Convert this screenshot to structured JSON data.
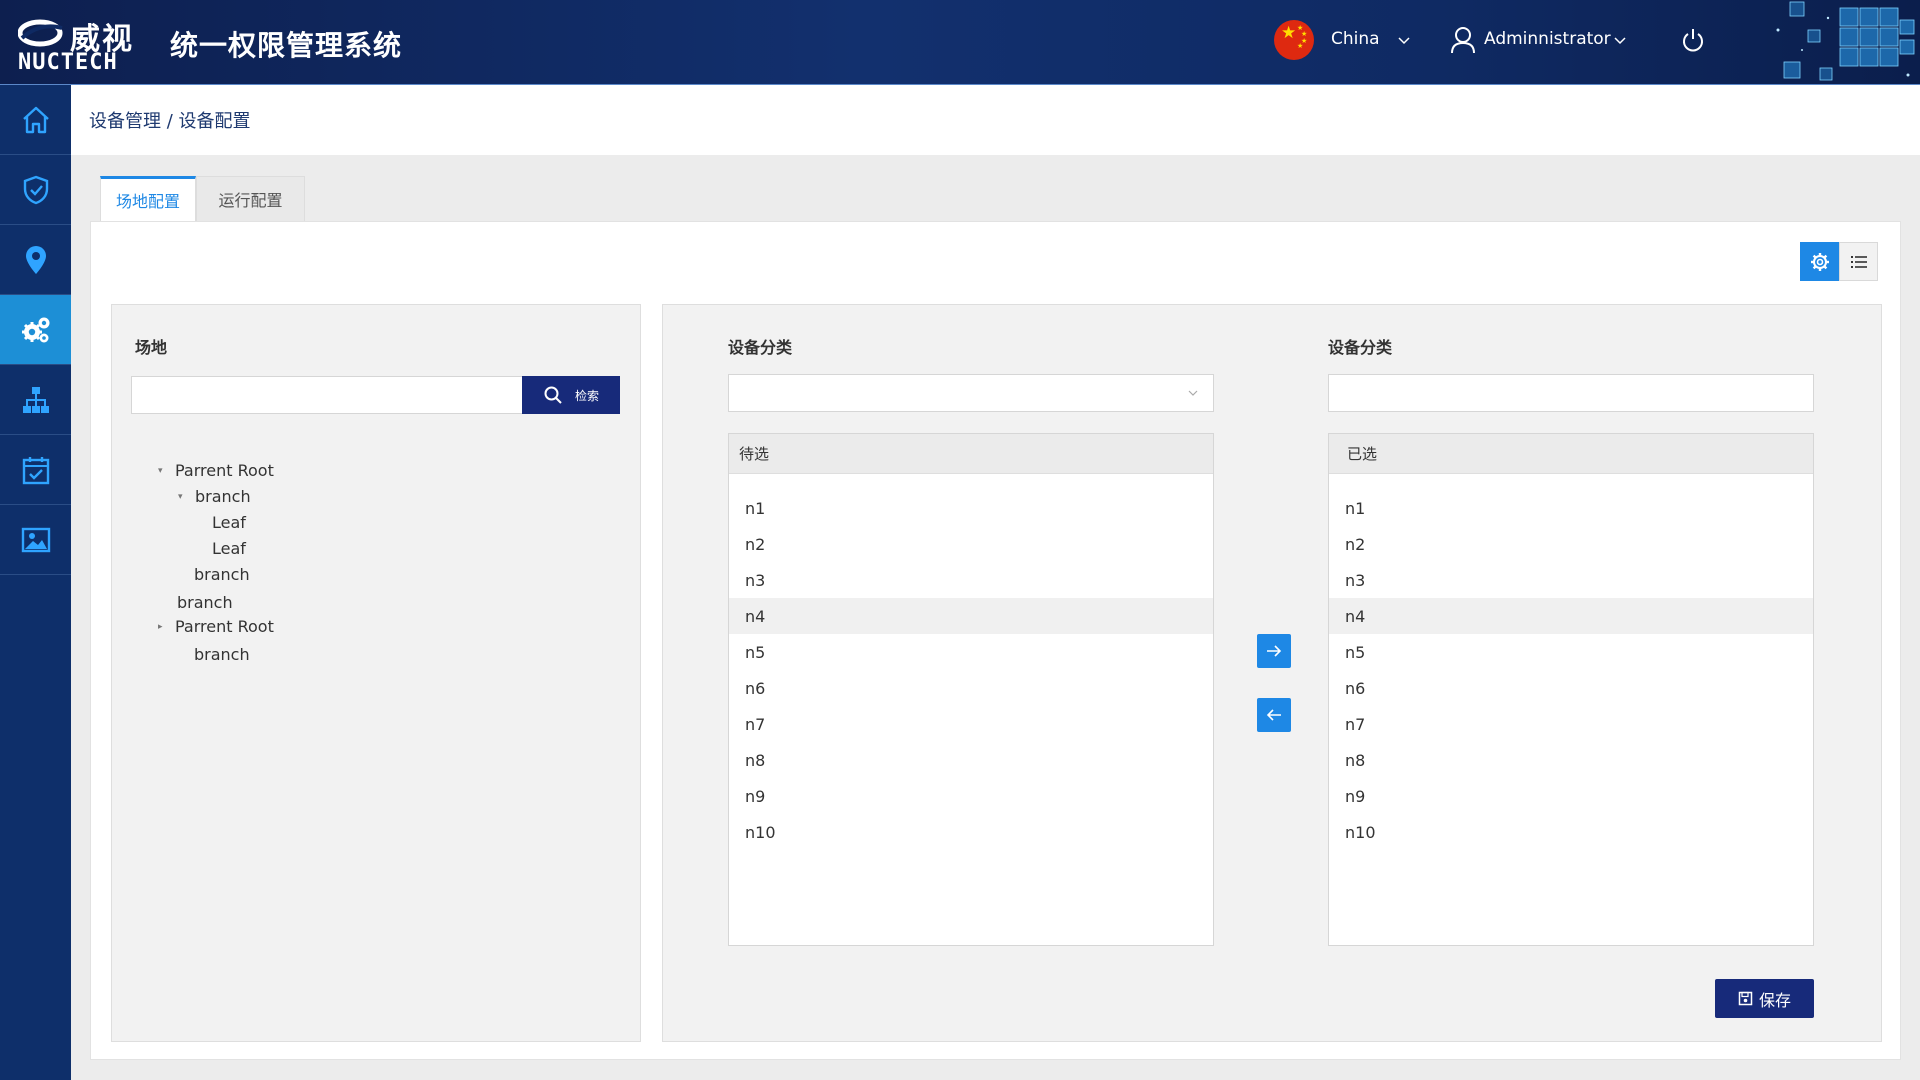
{
  "header": {
    "logo_cn": "威视",
    "logo_en": "NUCTECH",
    "app_title": "统一权限管理系统",
    "country": "China",
    "user": "Adminnistrator"
  },
  "sidebar": {
    "items": [
      {
        "icon": "home-icon"
      },
      {
        "icon": "shield-check-icon"
      },
      {
        "icon": "location-pin-icon"
      },
      {
        "icon": "gears-icon",
        "active": true
      },
      {
        "icon": "org-chart-icon"
      },
      {
        "icon": "calendar-check-icon"
      },
      {
        "icon": "image-icon"
      }
    ]
  },
  "breadcrumb": "设备管理 / 设备配置",
  "tabs": [
    {
      "label": "场地配置",
      "active": true
    },
    {
      "label": "运行配置",
      "active": false
    }
  ],
  "left_panel": {
    "title": "场地",
    "search_button": "检索",
    "tree": [
      {
        "label": "Parrent Root",
        "toggle": "▾"
      },
      {
        "label": "branch",
        "toggle": "▾"
      },
      {
        "label": "Leaf"
      },
      {
        "label": "Leaf"
      },
      {
        "label": "branch"
      },
      {
        "label": "branch"
      },
      {
        "label": "Parrent Root",
        "toggle": "▸"
      },
      {
        "label": "branch"
      }
    ]
  },
  "right_panel": {
    "left_title": "设备分类",
    "right_title": "设备分类",
    "pending_header": "待选",
    "selected_header": "已选",
    "pending_items": [
      "n1",
      "n2",
      "n3",
      "n4",
      "n5",
      "n6",
      "n7",
      "n8",
      "n9",
      "n10"
    ],
    "selected_items": [
      "n1",
      "n2",
      "n3",
      "n4",
      "n5",
      "n6",
      "n7",
      "n8",
      "n9",
      "n10"
    ],
    "highlighted_item": "n4",
    "save_button": "保存"
  },
  "colors": {
    "header_bg": "#0f2a63",
    "sidebar_bg": "#0e2f6a",
    "sidebar_active": "#1d8fd6",
    "primary_dark": "#172a7a",
    "accent_blue": "#1e88e5"
  }
}
